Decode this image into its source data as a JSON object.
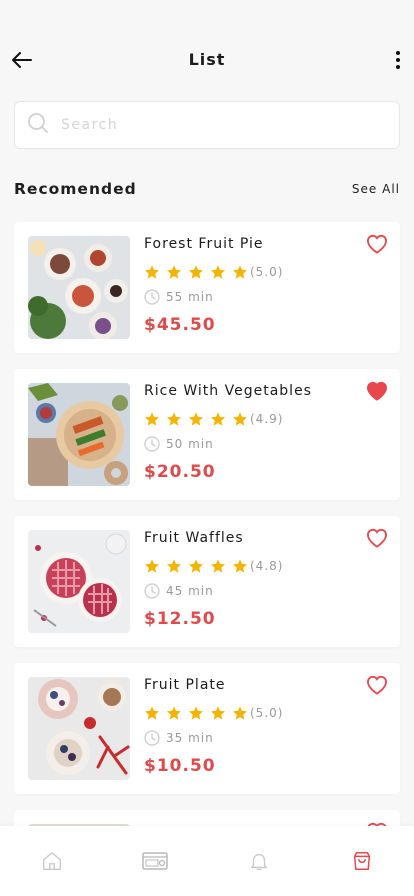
{
  "header": {
    "title": "List",
    "back_icon": "arrow-left-icon",
    "more_icon": "more-vertical-icon"
  },
  "search": {
    "placeholder": "Search",
    "value": "",
    "icon": "search-icon"
  },
  "section": {
    "title": "Recomended",
    "see_all": "See All"
  },
  "colors": {
    "price": "#e04a4a",
    "star": "#f4b400",
    "heart": "#e8474c",
    "muted": "#9a9a9a"
  },
  "items": [
    {
      "name": "Forest Fruit Pie",
      "rating": "(5.0)",
      "time": "55 min",
      "price": "$45.50",
      "favorite": false
    },
    {
      "name": "Rice With Vegetables",
      "rating": "(4.9)",
      "time": "50 min",
      "price": "$20.50",
      "favorite": true
    },
    {
      "name": "Fruit Waffles",
      "rating": "(4.8)",
      "time": "45 min",
      "price": "$12.50",
      "favorite": false
    },
    {
      "name": "Fruit Plate",
      "rating": "(5.0)",
      "time": "35 min",
      "price": "$10.50",
      "favorite": false
    }
  ],
  "bottom_nav": [
    {
      "icon": "home-icon",
      "active": false
    },
    {
      "icon": "wallet-icon",
      "active": false
    },
    {
      "icon": "bell-icon",
      "active": false
    },
    {
      "icon": "shopping-bag-icon",
      "active": true
    }
  ]
}
